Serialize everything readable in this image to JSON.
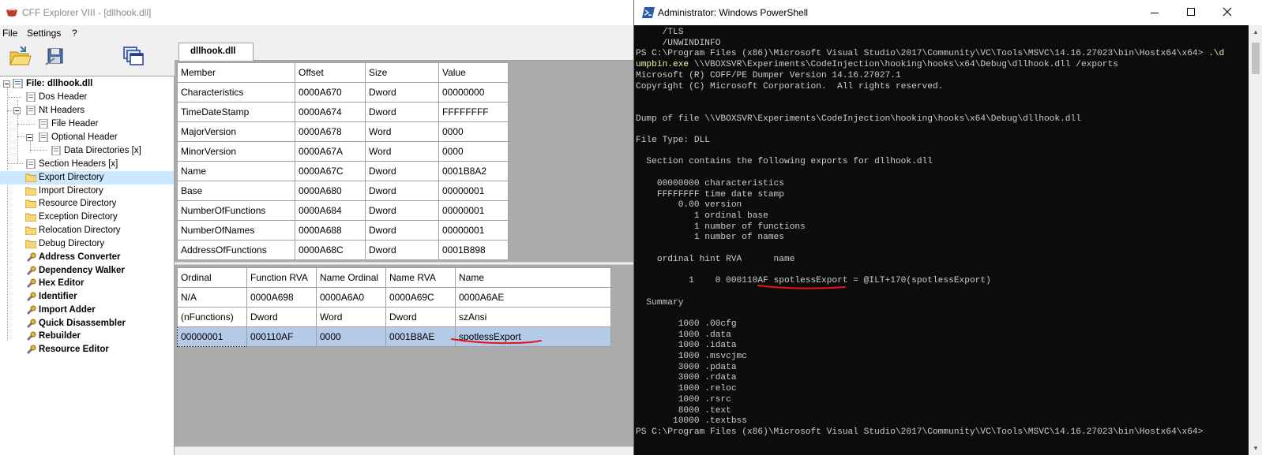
{
  "cff": {
    "title": "CFF Explorer VIII - [dllhook.dll]",
    "menu": [
      "File",
      "Settings",
      "?"
    ],
    "tab_label": "dllhook.dll",
    "tree": [
      {
        "label": "File: dllhook.dll",
        "bold": true,
        "icon": "file-icon"
      },
      {
        "label": "Dos Header",
        "bold": false,
        "icon": "page-icon"
      },
      {
        "label": "Nt Headers",
        "bold": false,
        "icon": "page-icon"
      },
      {
        "label": "File Header",
        "bold": false,
        "icon": "page-icon"
      },
      {
        "label": "Optional Header",
        "bold": false,
        "icon": "page-icon"
      },
      {
        "label": "Data Directories [x]",
        "bold": false,
        "icon": "page-icon"
      },
      {
        "label": "Section Headers [x]",
        "bold": false,
        "icon": "page-icon"
      },
      {
        "label": "Export Directory",
        "bold": false,
        "icon": "folder-icon",
        "selected": true
      },
      {
        "label": "Import Directory",
        "bold": false,
        "icon": "folder-icon"
      },
      {
        "label": "Resource Directory",
        "bold": false,
        "icon": "folder-icon"
      },
      {
        "label": "Exception Directory",
        "bold": false,
        "icon": "folder-icon"
      },
      {
        "label": "Relocation Directory",
        "bold": false,
        "icon": "folder-icon"
      },
      {
        "label": "Debug Directory",
        "bold": false,
        "icon": "folder-icon"
      },
      {
        "label": "Address Converter",
        "bold": true,
        "icon": "tool-icon"
      },
      {
        "label": "Dependency Walker",
        "bold": true,
        "icon": "tool-icon"
      },
      {
        "label": "Hex Editor",
        "bold": true,
        "icon": "tool-icon"
      },
      {
        "label": "Identifier",
        "bold": true,
        "icon": "tool-icon"
      },
      {
        "label": "Import Adder",
        "bold": true,
        "icon": "tool-icon"
      },
      {
        "label": "Quick Disassembler",
        "bold": true,
        "icon": "tool-icon"
      },
      {
        "label": "Rebuilder",
        "bold": true,
        "icon": "tool-icon"
      },
      {
        "label": "Resource Editor",
        "bold": true,
        "icon": "tool-icon"
      }
    ],
    "export_table": {
      "headers": [
        "Member",
        "Offset",
        "Size",
        "Value"
      ],
      "rows": [
        [
          "Characteristics",
          "0000A670",
          "Dword",
          "00000000"
        ],
        [
          "TimeDateStamp",
          "0000A674",
          "Dword",
          "FFFFFFFF"
        ],
        [
          "MajorVersion",
          "0000A678",
          "Word",
          "0000"
        ],
        [
          "MinorVersion",
          "0000A67A",
          "Word",
          "0000"
        ],
        [
          "Name",
          "0000A67C",
          "Dword",
          "0001B8A2"
        ],
        [
          "Base",
          "0000A680",
          "Dword",
          "00000001"
        ],
        [
          "NumberOfFunctions",
          "0000A684",
          "Dword",
          "00000001"
        ],
        [
          "NumberOfNames",
          "0000A688",
          "Dword",
          "00000001"
        ],
        [
          "AddressOfFunctions",
          "0000A68C",
          "Dword",
          "0001B898"
        ]
      ]
    },
    "functions_table": {
      "headers": [
        "Ordinal",
        "Function RVA",
        "Name Ordinal",
        "Name RVA",
        "Name"
      ],
      "rows": [
        [
          "N/A",
          "0000A698",
          "0000A6A0",
          "0000A69C",
          "0000A6AE"
        ],
        [
          "(nFunctions)",
          "Dword",
          "Word",
          "Dword",
          "szAnsi"
        ],
        [
          "00000001",
          "000110AF",
          "0000",
          "0001B8AE",
          "spotlessExport"
        ]
      ]
    }
  },
  "powershell": {
    "title": "Administrator: Windows PowerShell",
    "lines": [
      "     /TLS",
      "     /UNWINDINFO",
      "PS C:\\Program Files (x86)\\Microsoft Visual Studio\\2017\\Community\\VC\\Tools\\MSVC\\14.16.27023\\bin\\Hostx64\\x64> .\\d",
      "umpbin.exe \\\\VBOXSVR\\Experiments\\CodeInjection\\hooking\\hooks\\x64\\Debug\\dllhook.dll /exports",
      "Microsoft (R) COFF/PE Dumper Version 14.16.27027.1",
      "Copyright (C) Microsoft Corporation.  All rights reserved.",
      "",
      "",
      "Dump of file \\\\VBOXSVR\\Experiments\\CodeInjection\\hooking\\hooks\\x64\\Debug\\dllhook.dll",
      "",
      "File Type: DLL",
      "",
      "  Section contains the following exports for dllhook.dll",
      "",
      "    00000000 characteristics",
      "    FFFFFFFF time date stamp",
      "        0.00 version",
      "           1 ordinal base",
      "           1 number of functions",
      "           1 number of names",
      "",
      "    ordinal hint RVA      name",
      "",
      "          1    0 000110AF spotlessExport = @ILT+170(spotlessExport)",
      "",
      "  Summary",
      "",
      "        1000 .00cfg",
      "        1000 .data",
      "        1000 .idata",
      "        1000 .msvcjmc",
      "        3000 .pdata",
      "        3000 .rdata",
      "        1000 .reloc",
      "        1000 .rsrc",
      "        8000 .text",
      "       10000 .textbss",
      "PS C:\\Program Files (x86)\\Microsoft Visual Studio\\2017\\Community\\VC\\Tools\\MSVC\\14.16.27023\\bin\\Hostx64\\x64>"
    ]
  },
  "colors": {
    "selection": "#cce8ff",
    "grid_highlight": "#b3cbe6",
    "annotation_red": "#e8121a",
    "console_bg": "#0c0c0c",
    "console_text": "#cccccc",
    "command_yellow": "#f9f1a5"
  }
}
